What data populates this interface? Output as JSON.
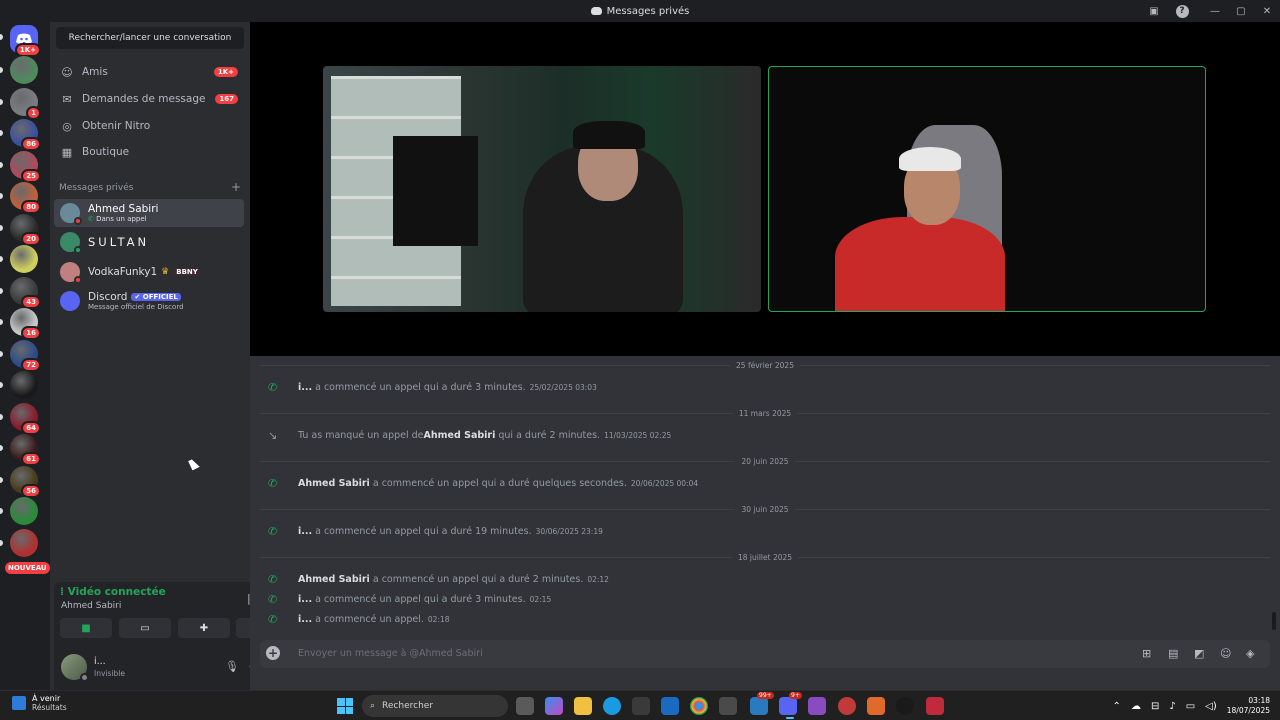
{
  "window": {
    "title": "Messages privés",
    "min": "—",
    "max": "▢",
    "close": "✕",
    "help": "?"
  },
  "rail": {
    "home_badge": "1K+",
    "servers": [
      {
        "badge": "",
        "color": "#4e8a5e"
      },
      {
        "badge": "1",
        "color": "#7a7d80"
      },
      {
        "badge": "86",
        "color": "#3b4fa0"
      },
      {
        "badge": "25",
        "color": "#b04a5a"
      },
      {
        "badge": "80",
        "color": "#c0603a"
      },
      {
        "badge": "20",
        "color": "#2b2b2b"
      },
      {
        "badge": "",
        "color": "#cfcf60"
      },
      {
        "badge": "43",
        "color": "#3a3a3a"
      },
      {
        "badge": "16",
        "color": "#c8c8c8"
      },
      {
        "badge": "72",
        "color": "#2a4a8a"
      },
      {
        "badge": "",
        "color": "#1a1a1a"
      },
      {
        "badge": "64",
        "color": "#8a1a2a"
      },
      {
        "badge": "61",
        "color": "#3a1a1a"
      },
      {
        "badge": "56",
        "color": "#4a3a1a"
      },
      {
        "badge": "",
        "color": "#2a8a3a"
      },
      {
        "badge": "",
        "color": "#b03030"
      }
    ],
    "new_label": "NOUVEAU"
  },
  "dm_sidebar": {
    "search_placeholder": "Rechercher/lancer une conversation",
    "nav": [
      {
        "label": "Amis",
        "badge": "1K+",
        "icon": "friends-icon"
      },
      {
        "label": "Demandes de message",
        "badge": "167",
        "icon": "mail-icon"
      },
      {
        "label": "Obtenir Nitro",
        "badge": "",
        "icon": "nitro-icon"
      },
      {
        "label": "Boutique",
        "badge": "",
        "icon": "shop-icon"
      }
    ],
    "dm_header": "Messages privés",
    "dm_add": "+",
    "dms": [
      {
        "name": "Ahmed Sabiri",
        "sub": "Dans un appel",
        "color": "#6a8a9a",
        "status": "#f23f43"
      },
      {
        "name": "SULTAN",
        "sub": "",
        "color": "#3a8a6a",
        "status": "#23a55a"
      },
      {
        "name": "VodkaFunky1",
        "sub": "",
        "tag": "BBNY",
        "color": "#c08080",
        "status": "#f23f43"
      },
      {
        "name": "Discord",
        "sub": "Message officiel de Discord",
        "tag": "OFFICIEL",
        "color": "#5865f2",
        "status": ""
      }
    ]
  },
  "voice": {
    "status": "Vidéo connectée",
    "channel_user": "Ahmed Sabiri",
    "buttons": [
      "camera-icon",
      "screen-share-icon",
      "activity-icon",
      "soundboard-icon"
    ]
  },
  "user": {
    "name": "i...",
    "status": "Invisible"
  },
  "chat": {
    "entries": [
      {
        "type": "date",
        "text": "25 février 2025"
      },
      {
        "type": "call",
        "missed": false,
        "user": "i...",
        "text": " a commencé un appel qui a duré 3 minutes.",
        "ts": "25/02/2025 03:03"
      },
      {
        "type": "date",
        "text": "11 mars 2025"
      },
      {
        "type": "call",
        "missed": true,
        "prefix": "Tu as manqué un appel de ",
        "user": "Ahmed Sabiri",
        "text": " qui a duré 2 minutes.",
        "ts": "11/03/2025 02:25"
      },
      {
        "type": "date",
        "text": "20 juin 2025"
      },
      {
        "type": "call",
        "missed": false,
        "user": "Ahmed Sabiri",
        "text": " a commencé un appel qui a duré quelques secondes.",
        "ts": "20/06/2025 00:04"
      },
      {
        "type": "date",
        "text": "30 juin 2025"
      },
      {
        "type": "call",
        "missed": false,
        "user": "i...",
        "text": " a commencé un appel qui a duré 19 minutes.",
        "ts": "30/06/2025 23:19"
      },
      {
        "type": "date",
        "text": "18 juillet 2025"
      },
      {
        "type": "call",
        "missed": false,
        "user": "Ahmed Sabiri",
        "text": " a commencé un appel qui a duré 2 minutes.",
        "ts": "02:12"
      },
      {
        "type": "call",
        "missed": false,
        "user": "i...",
        "text": " a commencé un appel qui a duré 3 minutes.",
        "ts": "02:15"
      },
      {
        "type": "call",
        "missed": false,
        "user": "i...",
        "text": " a commencé un appel.",
        "ts": "02:18"
      }
    ],
    "composer_placeholder": "Envoyer un message à @Ahmed Sabiri"
  },
  "taskbar": {
    "weather_title": "À venir",
    "weather_sub": "Résultats",
    "search": "Rechercher",
    "badge1": "99+",
    "badge2": "9+",
    "time": "03:18",
    "date": "18/07/2025"
  }
}
